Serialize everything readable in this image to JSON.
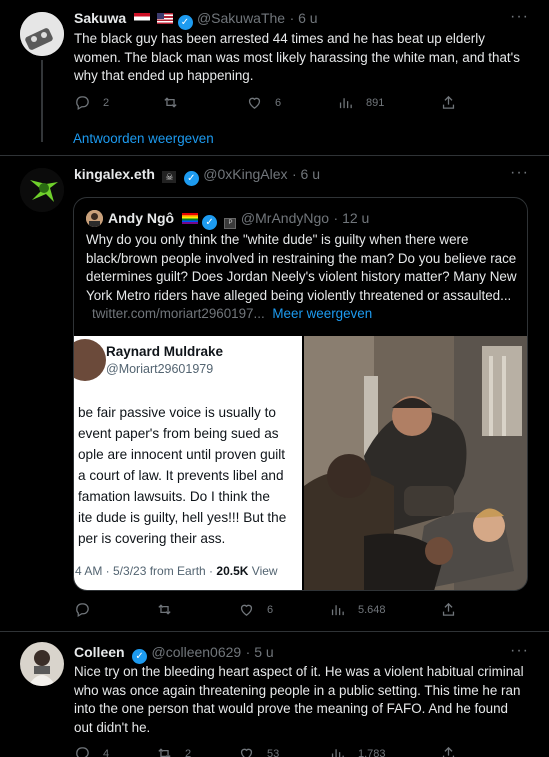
{
  "tweets": [
    {
      "name": "Sakuwa",
      "handle": "@SakuwaThe",
      "time": "· 6 u",
      "text": "The black guy has been arrested 44 times and he has beat up elderly women. The black man was most likely harassing the white man, and that's why that ended up happening.",
      "replies": "2",
      "retweets": "",
      "likes": "6",
      "views": "891",
      "show_replies": "Antwoorden weergeven"
    },
    {
      "name": "kingalex.eth",
      "handle": "@0xKingAlex",
      "time": "· 6 u",
      "quote": {
        "name": "Andy Ngô",
        "handle": "@MrAndyNgo",
        "time": "· 12 u",
        "text": "Why do you only think the \"white dude\" is guilty when there were black/brown people involved in restraining the man? Do you believe race determines guilt? Does Jordan Neely's violent history matter? Many New York Metro riders have alleged being violently threatened or assaulted...",
        "url": "twitter.com/moriart2960197...",
        "more": "Meer weergeven",
        "embedded": {
          "name": "Raynard Muldrake",
          "handle": "@Moriart29601979",
          "lines": [
            "be fair passive voice is usually to",
            "event paper's from being sued as",
            "ople are innocent until proven guilt",
            "a court of law. It prevents libel and",
            "famation lawsuits. Do I think the",
            "ite dude is guilty, hell yes!!! But the",
            "per is covering their ass."
          ],
          "meta": "4 AM · 5/3/23 from Earth ·",
          "views": "20.5K",
          "views_label": "View"
        }
      },
      "replies": "",
      "retweets": "",
      "likes": "6",
      "views": "5.648"
    },
    {
      "name": "Colleen",
      "handle": "@colleen0629",
      "time": "· 5 u",
      "text": "Nice try on the bleeding heart aspect of it. He was a violent habitual criminal who was once again threatening people in a public setting. This time he ran into the one person that would prove the meaning of FAFO. And he found out didn't he.",
      "replies": "4",
      "retweets": "2",
      "likes": "53",
      "views": "1.783"
    }
  ],
  "colors": {
    "accent": "#1d9bf0",
    "muted": "#71767b",
    "text": "#e7e9ea",
    "bg": "#000000"
  }
}
